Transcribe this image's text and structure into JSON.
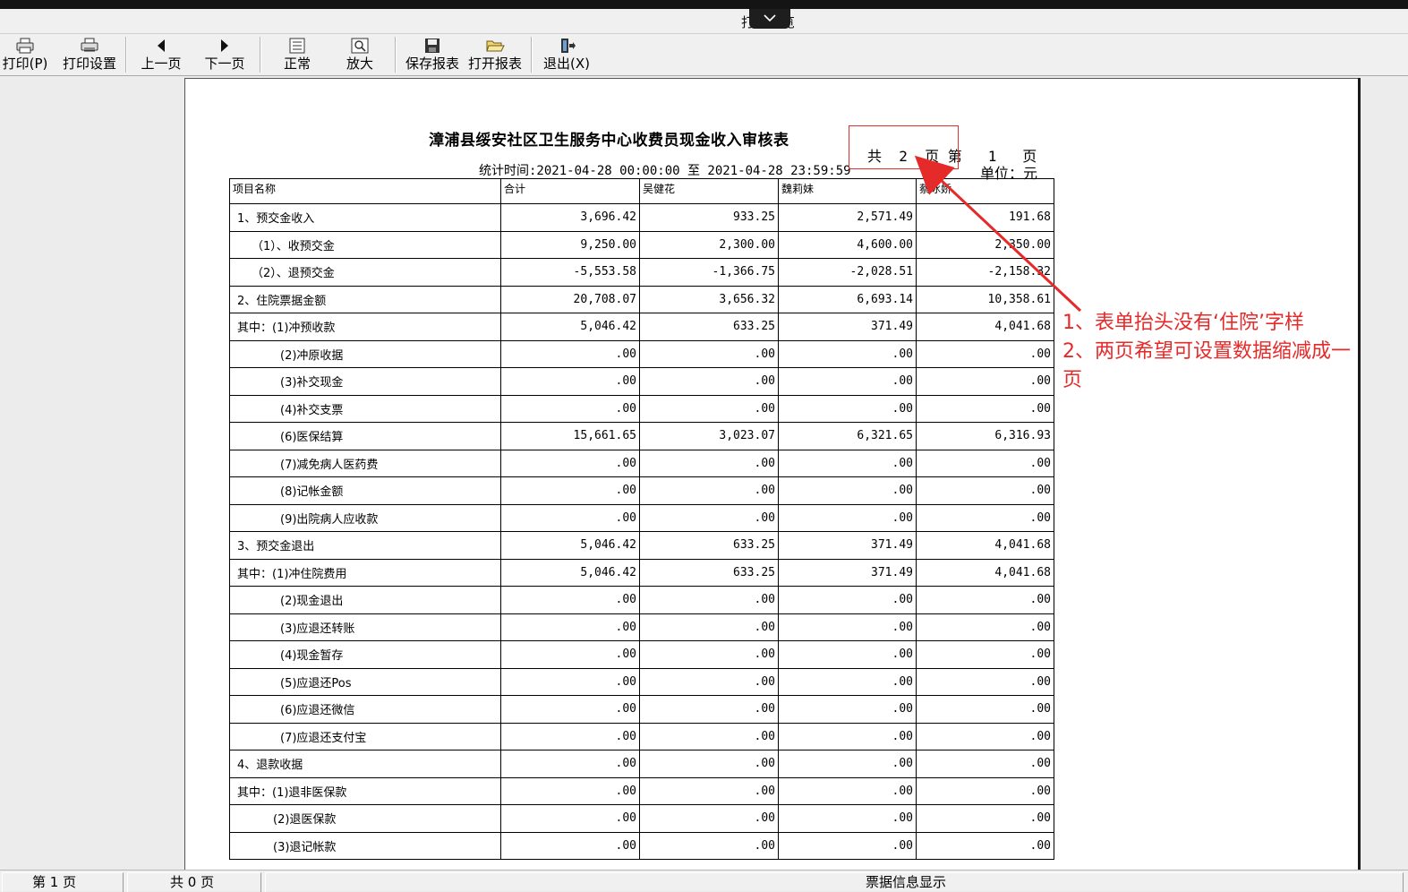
{
  "window": {
    "title": "打印预览"
  },
  "toolbar": {
    "print": "打印(P)",
    "print_setup": "打印设置",
    "prev_page": "上一页",
    "next_page": "下一页",
    "normal": "正常",
    "zoom": "放大",
    "save_report": "保存报表",
    "open_report": "打开报表",
    "exit": "退出(X)"
  },
  "report": {
    "title": "漳浦县绥安社区卫生服务中心收费员现金收入审核表",
    "page_info": "共  2  页 第   1   页",
    "stat_time": "统计时间:2021-04-28 00:00:00 至 2021-04-28 23:59:59",
    "unit": "单位：元",
    "headers": [
      "项目名称",
      "合计",
      "吴健花",
      "魏莉妹",
      "蔡冰娇"
    ],
    "rows": [
      {
        "name": "1、预交金收入",
        "v": [
          "3,696.42",
          "933.25",
          "2,571.49",
          "191.68"
        ]
      },
      {
        "name": "（1）、收预交金",
        "v": [
          "9,250.00",
          "2,300.00",
          "4,600.00",
          "2,350.00"
        ]
      },
      {
        "name": "（2）、退预交金",
        "v": [
          "-5,553.58",
          "-1,366.75",
          "-2,028.51",
          "-2,158.32"
        ]
      },
      {
        "name": "2、住院票据金额",
        "v": [
          "20,708.07",
          "3,656.32",
          "6,693.14",
          "10,358.61"
        ]
      },
      {
        "name": "其中：(1)冲预收款",
        "v": [
          "5,046.42",
          "633.25",
          "371.49",
          "4,041.68"
        ]
      },
      {
        "name": "(2)冲原收据",
        "v": [
          ".00",
          ".00",
          ".00",
          ".00"
        ]
      },
      {
        "name": "(3)补交现金",
        "v": [
          ".00",
          ".00",
          ".00",
          ".00"
        ]
      },
      {
        "name": "(4)补交支票",
        "v": [
          ".00",
          ".00",
          ".00",
          ".00"
        ]
      },
      {
        "name": "(6)医保结算",
        "v": [
          "15,661.65",
          "3,023.07",
          "6,321.65",
          "6,316.93"
        ]
      },
      {
        "name": "(7)减免病人医药费",
        "v": [
          ".00",
          ".00",
          ".00",
          ".00"
        ]
      },
      {
        "name": "(8)记帐金额",
        "v": [
          ".00",
          ".00",
          ".00",
          ".00"
        ]
      },
      {
        "name": "(9)出院病人应收款",
        "v": [
          ".00",
          ".00",
          ".00",
          ".00"
        ]
      },
      {
        "name": "3、预交金退出",
        "v": [
          "5,046.42",
          "633.25",
          "371.49",
          "4,041.68"
        ]
      },
      {
        "name": "其中：(1)冲住院费用",
        "v": [
          "5,046.42",
          "633.25",
          "371.49",
          "4,041.68"
        ]
      },
      {
        "name": "(2)现金退出",
        "v": [
          ".00",
          ".00",
          ".00",
          ".00"
        ]
      },
      {
        "name": "(3)应退还转账",
        "v": [
          ".00",
          ".00",
          ".00",
          ".00"
        ]
      },
      {
        "name": "(4)现金暂存",
        "v": [
          ".00",
          ".00",
          ".00",
          ".00"
        ]
      },
      {
        "name": "(5)应退还Pos",
        "v": [
          ".00",
          ".00",
          ".00",
          ".00"
        ]
      },
      {
        "name": "(6)应退还微信",
        "v": [
          ".00",
          ".00",
          ".00",
          ".00"
        ]
      },
      {
        "name": "(7)应退还支付宝",
        "v": [
          ".00",
          ".00",
          ".00",
          ".00"
        ]
      },
      {
        "name": "4、退款收据",
        "v": [
          ".00",
          ".00",
          ".00",
          ".00"
        ]
      },
      {
        "name": "其中：(1)退非医保款",
        "v": [
          ".00",
          ".00",
          ".00",
          ".00"
        ]
      },
      {
        "name": "(2)退医保款",
        "v": [
          ".00",
          ".00",
          ".00",
          ".00"
        ]
      },
      {
        "name": "(3)退记帐款",
        "v": [
          ".00",
          ".00",
          ".00",
          ".00"
        ]
      }
    ]
  },
  "annotation": {
    "line1": "1、表单抬头没有‘住院’字样",
    "line2": "2、两页希望可设置数据缩减成一页",
    "color": "#e52a2a"
  },
  "statusbar": {
    "current_page": "第 1 页",
    "total_pages": "共 0 页",
    "info": "票据信息显示"
  }
}
